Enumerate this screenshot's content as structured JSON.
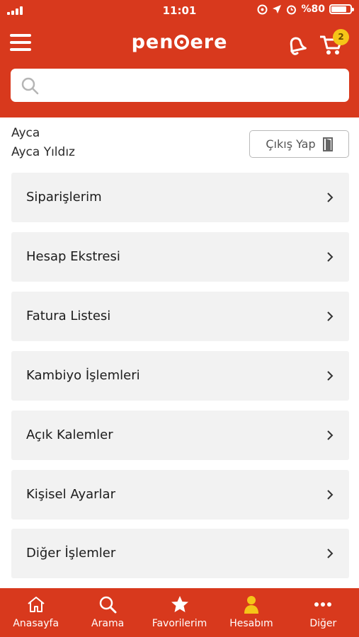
{
  "status_bar": {
    "time": "11:01",
    "battery": "%80",
    "battery_level": 0.8
  },
  "header": {
    "logo": {
      "prefix": "pen",
      "suffix": "ere"
    },
    "cart_count": "2"
  },
  "search": {
    "placeholder": "",
    "value": ""
  },
  "user": {
    "first_name": "Ayca",
    "full_name": "Ayca Yıldız",
    "logout_label": "Çıkış Yap"
  },
  "menu_items": [
    {
      "label": "Siparişlerim"
    },
    {
      "label": "Hesap Ekstresi"
    },
    {
      "label": "Fatura Listesi"
    },
    {
      "label": "Kambiyo İşlemleri"
    },
    {
      "label": "Açık Kalemler"
    },
    {
      "label": "Kişisel Ayarlar"
    },
    {
      "label": "Diğer İşlemler"
    }
  ],
  "tab_bar": [
    {
      "label": "Anasayfa",
      "icon": "home-icon"
    },
    {
      "label": "Arama",
      "icon": "search-icon"
    },
    {
      "label": "Favorilerim",
      "icon": "star-icon"
    },
    {
      "label": "Hesabım",
      "icon": "user-icon",
      "active": true
    },
    {
      "label": "Diğer",
      "icon": "more-icon"
    }
  ],
  "colors": {
    "brand": "#d8391d",
    "badge": "#f5c518",
    "active_tab_icon": "#f5c518"
  }
}
